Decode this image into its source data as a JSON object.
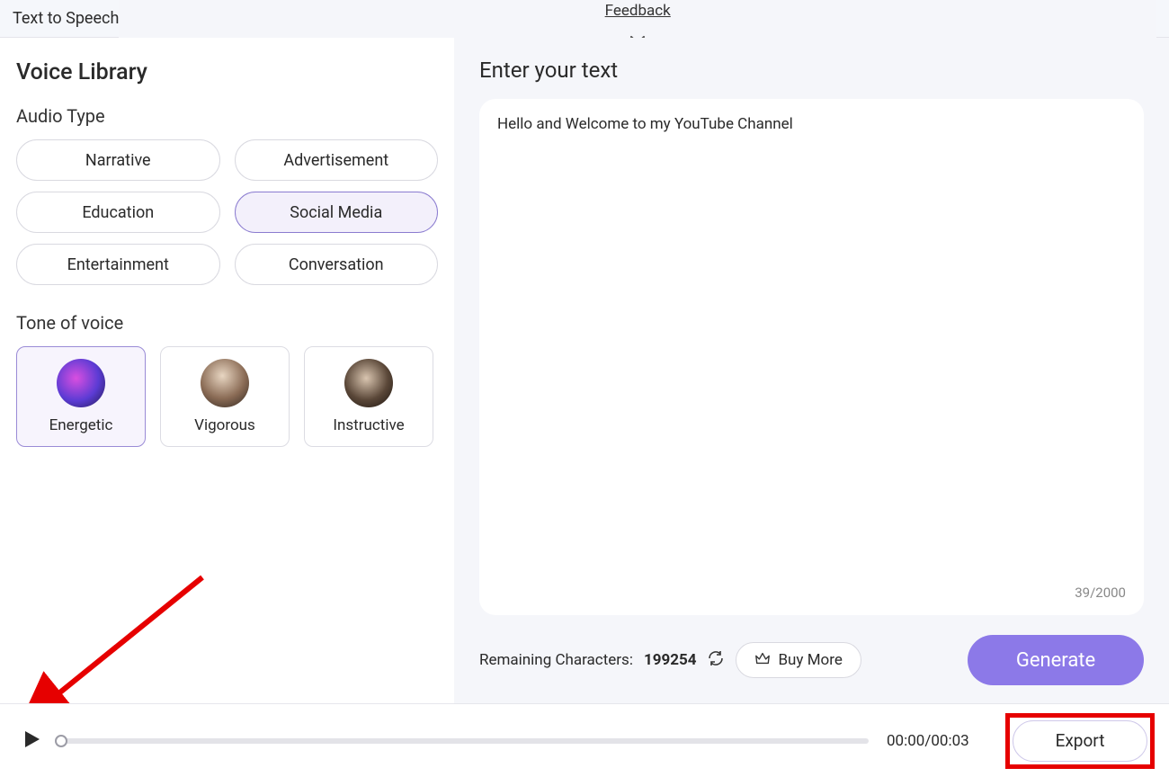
{
  "titlebar": {
    "title": "Text to Speech",
    "feedback": "Feedback"
  },
  "left": {
    "heading": "Voice Library",
    "audio_type_label": "Audio Type",
    "audio_types": [
      "Narrative",
      "Advertisement",
      "Education",
      "Social Media",
      "Entertainment",
      "Conversation"
    ],
    "audio_type_selected_index": 3,
    "tone_label": "Tone of voice",
    "tones": [
      {
        "label": "Energetic",
        "avatar_bg": "radial-gradient(circle at 40% 40%, #d94fe0 0%, #5b3bd4 55%, #211a4c 100%)"
      },
      {
        "label": "Vigorous",
        "avatar_bg": "radial-gradient(circle at 45% 35%, #e8d6c2 0%, #8a6b55 55%, #2d241e 100%)"
      },
      {
        "label": "Instructive",
        "avatar_bg": "radial-gradient(circle at 45% 40%, #d9c5b0 0%, #5a4738 55%, #1a120d 100%)"
      }
    ],
    "tone_selected_index": 0
  },
  "right": {
    "heading": "Enter your text",
    "text_content": "Hello and Welcome to my YouTube Channel",
    "char_count": "39/2000",
    "remaining_label": "Remaining Characters:",
    "remaining_value": "199254",
    "buy_more": "Buy More",
    "generate": "Generate"
  },
  "playbar": {
    "time": "00:00/00:03",
    "export": "Export"
  }
}
